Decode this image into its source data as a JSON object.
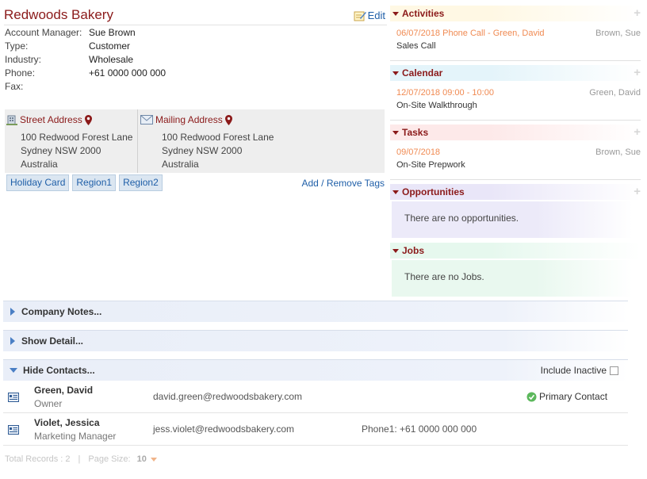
{
  "company": {
    "name": "Redwoods Bakery",
    "edit_label": "Edit",
    "fields": [
      {
        "label": "Account Manager:",
        "value": "Sue Brown"
      },
      {
        "label": "Type:",
        "value": "Customer"
      },
      {
        "label": "Industry:",
        "value": "Wholesale"
      },
      {
        "label": "Phone:",
        "value": "+61 0000 000 000"
      },
      {
        "label": "Fax:",
        "value": ""
      }
    ],
    "street_address": {
      "label": "Street Address",
      "lines": [
        "100 Redwood Forest Lane",
        "Sydney NSW 2000",
        "Australia"
      ]
    },
    "mailing_address": {
      "label": "Mailing Address",
      "lines": [
        "100 Redwood Forest Lane",
        "Sydney NSW 2000",
        "Australia"
      ]
    },
    "tags": [
      "Holiday Card",
      "Region1",
      "Region2"
    ],
    "add_remove_tags": "Add / Remove Tags"
  },
  "panels": {
    "activities": {
      "title": "Activities",
      "item": {
        "date": "06/07/2018 Phone Call - Green, David",
        "owner": "Brown, Sue",
        "subject": "Sales Call"
      }
    },
    "calendar": {
      "title": "Calendar",
      "item": {
        "date": "12/07/2018 09:00 - 10:00",
        "owner": "Green, David",
        "subject": "On-Site Walkthrough"
      }
    },
    "tasks": {
      "title": "Tasks",
      "item": {
        "date": "09/07/2018",
        "owner": "Brown, Sue",
        "subject": "On-Site Prepwork"
      }
    },
    "opportunities": {
      "title": "Opportunities",
      "empty": "There are no opportunities."
    },
    "jobs": {
      "title": "Jobs",
      "empty": "There are no Jobs."
    }
  },
  "bars": {
    "company_notes": "Company Notes...",
    "show_detail": "Show Detail...",
    "hide_contacts": "Hide Contacts...",
    "include_inactive": "Include Inactive"
  },
  "contacts": [
    {
      "name": "Green, David",
      "title": "Owner",
      "email": "david.green@redwoodsbakery.com",
      "phone": "",
      "primary": "Primary Contact"
    },
    {
      "name": "Violet, Jessica",
      "title": "Marketing Manager",
      "email": "jess.violet@redwoodsbakery.com",
      "phone": "Phone1: +61 0000 000 000",
      "primary": ""
    }
  ],
  "footer": {
    "total_records": "Total Records : 2",
    "separator": "|",
    "page_size_label": "Page Size:",
    "page_size_value": "10"
  },
  "colors": {
    "accent_red": "#8b1a1a",
    "link_blue": "#1f5fa8",
    "date_orange": "#f08a52",
    "activities_bg": "#fff8e4",
    "calendar_bg": "#e4f4fa",
    "tasks_bg": "#fde9e9",
    "opportunities_bg": "#e9e6f8",
    "jobs_bg": "#e6f8ee"
  }
}
